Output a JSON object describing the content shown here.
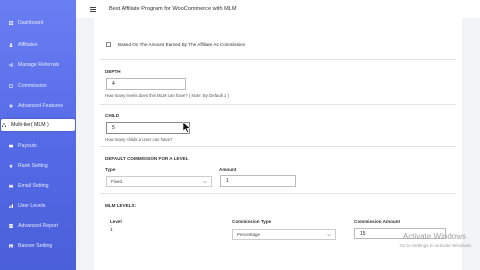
{
  "sidebar": {
    "items": [
      {
        "label": "Dashboard"
      },
      {
        "label": "Affiliates"
      },
      {
        "label": "Manage Referrals"
      },
      {
        "label": "Commission"
      },
      {
        "label": "Advanced Features"
      },
      {
        "label": "Multi-tier( MLM )"
      },
      {
        "label": "Payouts"
      },
      {
        "label": "Rank Setting"
      },
      {
        "label": "Email Setting"
      },
      {
        "label": "User Levels"
      },
      {
        "label": "Advanced Report"
      },
      {
        "label": "Banner Setting"
      }
    ],
    "active_index": 5
  },
  "header": {
    "title": "Best Affiliate Program for WooCommerce with MLM"
  },
  "form": {
    "commission_checkbox_label": "Based On The Amount Earned By The Affiliate As Commission",
    "depth_label": "DEPTH",
    "depth_value": "4",
    "depth_hint": "How many levels does this MLM can have? ( Note: By Default 1 )",
    "child_label": "CHILD",
    "child_value": "5",
    "child_hint": "How many childs a User can have?",
    "default_commission_title": "DEFAULT COMMISSION FOR A LEVEL",
    "type_label": "Type",
    "type_value": "Fixed",
    "amount_label": "Amount",
    "amount_value": "1",
    "mlm_levels_title": "MLM LEVELS:",
    "levels_columns": [
      "Level",
      "Commission Type",
      "Commission Amount"
    ],
    "levels_rows": [
      {
        "level": "1",
        "commission_type": "Percentage",
        "commission_amount": "15"
      }
    ]
  },
  "watermark": {
    "title": "Activate Windows",
    "subtitle": "Go to Settings to activate Windows."
  },
  "colors": {
    "sidebar_top": "#6a7ef3",
    "sidebar_bottom": "#4a5fd9",
    "panel_bg": "#ffffff",
    "page_bg": "#f2f3f5"
  }
}
